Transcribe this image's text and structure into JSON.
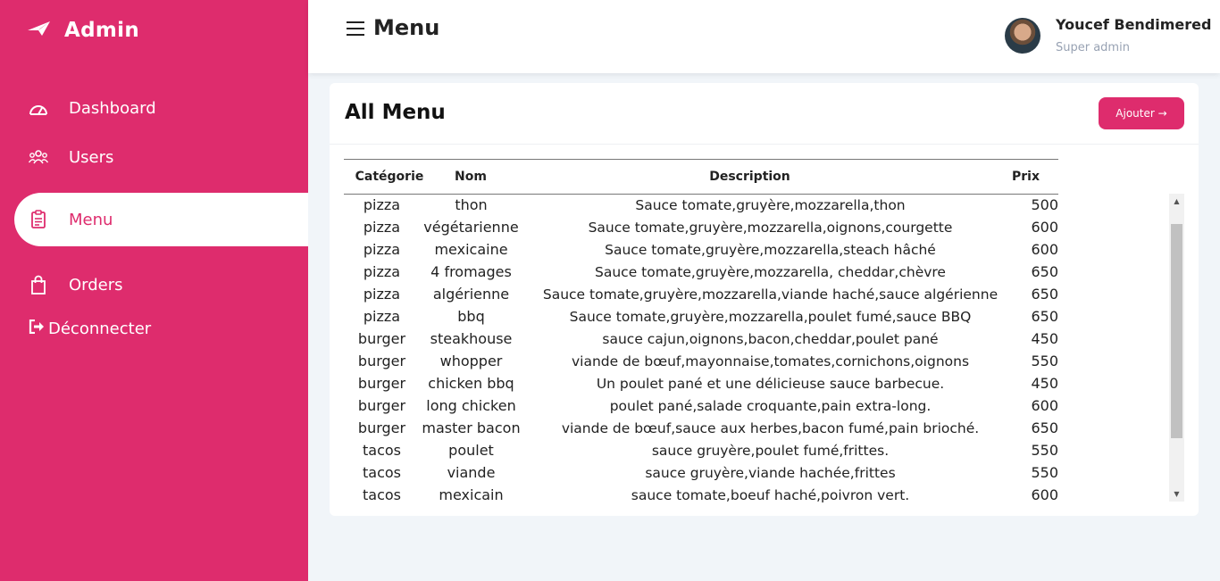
{
  "brand": {
    "name": "Admin",
    "icon": "paper-plane-icon"
  },
  "sidebar": {
    "items": [
      {
        "label": "Dashboard",
        "icon": "dashboard-gauge-icon"
      },
      {
        "label": "Users",
        "icon": "users-group-icon"
      },
      {
        "label": "Menu",
        "icon": "clipboard-list-icon",
        "active": true
      },
      {
        "label": "Orders",
        "icon": "shopping-bag-icon"
      }
    ],
    "logout": {
      "label": "Déconnecter",
      "icon": "sign-out-icon"
    }
  },
  "header": {
    "title": "Menu",
    "user": {
      "name": "Youcef Bendimered",
      "role": "Super admin"
    }
  },
  "card": {
    "title": "All Menu",
    "add_button": "Ajouter →"
  },
  "table": {
    "headers": [
      "Catégorie",
      "Nom",
      "Description",
      "Prix"
    ],
    "rows": [
      [
        "pizza",
        "thon",
        "Sauce tomate,gruyère,mozzarella,thon",
        "500"
      ],
      [
        "pizza",
        "végétarienne",
        "Sauce tomate,gruyère,mozzarella,oignons,courgette",
        "600"
      ],
      [
        "pizza",
        "mexicaine",
        "Sauce tomate,gruyère,mozzarella,steach hâché",
        "600"
      ],
      [
        "pizza",
        "4 fromages",
        "Sauce tomate,gruyère,mozzarella, cheddar,chèvre",
        "650"
      ],
      [
        "pizza",
        "algérienne",
        "Sauce tomate,gruyère,mozzarella,viande haché,sauce algérienne",
        "650"
      ],
      [
        "pizza",
        "bbq",
        "Sauce tomate,gruyère,mozzarella,poulet fumé,sauce BBQ",
        "650"
      ],
      [
        "burger",
        "steakhouse",
        "sauce cajun,oignons,bacon,cheddar,poulet pané",
        "450"
      ],
      [
        "burger",
        "whopper",
        "viande de bœuf,mayonnaise,tomates,cornichons,oignons",
        "550"
      ],
      [
        "burger",
        "chicken bbq",
        "Un poulet pané et une délicieuse sauce barbecue.",
        "450"
      ],
      [
        "burger",
        "long chicken",
        "poulet pané,salade croquante,pain extra-long.",
        "600"
      ],
      [
        "burger",
        "master bacon",
        "viande de bœuf,sauce aux herbes,bacon fumé,pain brioché.",
        "650"
      ],
      [
        "tacos",
        "poulet",
        "sauce gruyère,poulet fumé,frittes.",
        "550"
      ],
      [
        "tacos",
        "viande",
        "sauce gruyère,viande hachée,frittes",
        "550"
      ],
      [
        "tacos",
        "mexicain",
        "sauce tomate,boeuf haché,poivron vert.",
        "600"
      ]
    ]
  },
  "colors": {
    "accent": "#de2c6d",
    "background": "#f1f5f9"
  }
}
